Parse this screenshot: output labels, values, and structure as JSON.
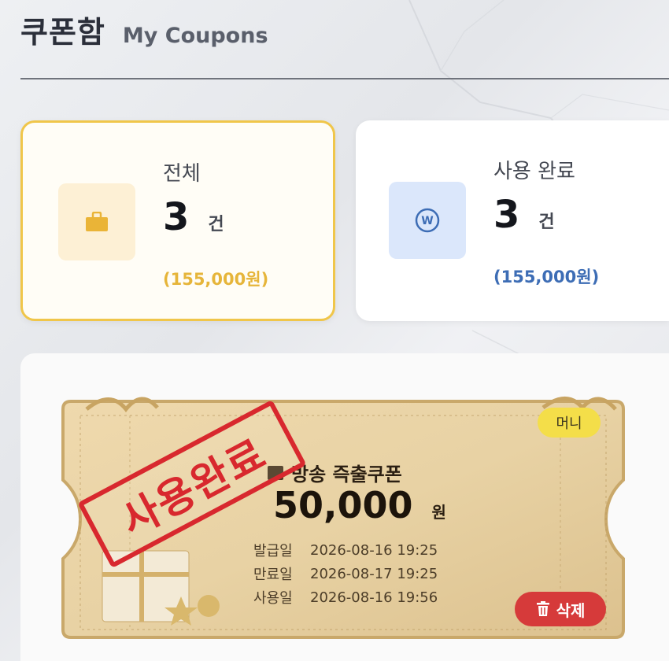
{
  "header": {
    "title_ko": "쿠폰함",
    "title_en": "My Coupons"
  },
  "stats": {
    "total": {
      "label": "전체",
      "count": "3",
      "unit": "건",
      "amount": "(155,000원)",
      "icon": "bag-icon",
      "accent": "#f0c64a"
    },
    "used": {
      "label": "사용 완료",
      "count": "3",
      "unit": "건",
      "amount": "(155,000원)",
      "icon": "won-icon",
      "accent": "#3d6db5"
    }
  },
  "coupon": {
    "badge": "머니",
    "name": "방송 즉출쿠폰",
    "amount": "50,000",
    "unit": "원",
    "stamp": "사용완료",
    "dates": [
      {
        "label": "발급일",
        "value": "2026-08-16 19:25"
      },
      {
        "label": "만료일",
        "value": "2026-08-17 19:25"
      },
      {
        "label": "사용일",
        "value": "2026-08-16 19:56"
      }
    ],
    "delete_label": "삭제"
  }
}
